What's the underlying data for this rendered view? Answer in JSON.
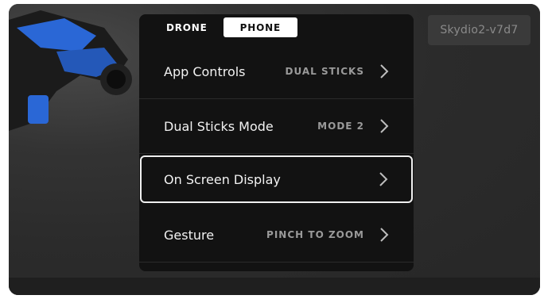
{
  "device": {
    "name": "Skydio2-v7d7"
  },
  "tabs": [
    {
      "label": "DRONE",
      "active": false
    },
    {
      "label": "PHONE",
      "active": true
    }
  ],
  "settings": [
    {
      "label": "App Controls",
      "value": "DUAL STICKS",
      "selected": false
    },
    {
      "label": "Dual Sticks Mode",
      "value": "MODE 2",
      "selected": false
    },
    {
      "label": "On Screen Display",
      "value": "",
      "selected": true
    },
    {
      "label": "Gesture",
      "value": "PINCH TO ZOOM",
      "selected": false
    }
  ],
  "colors": {
    "accent_drone": "#2a67d6",
    "panel": "#121212",
    "text": "#f2f2f2"
  },
  "icons": {
    "row_arrow": "chevron-right-icon"
  }
}
